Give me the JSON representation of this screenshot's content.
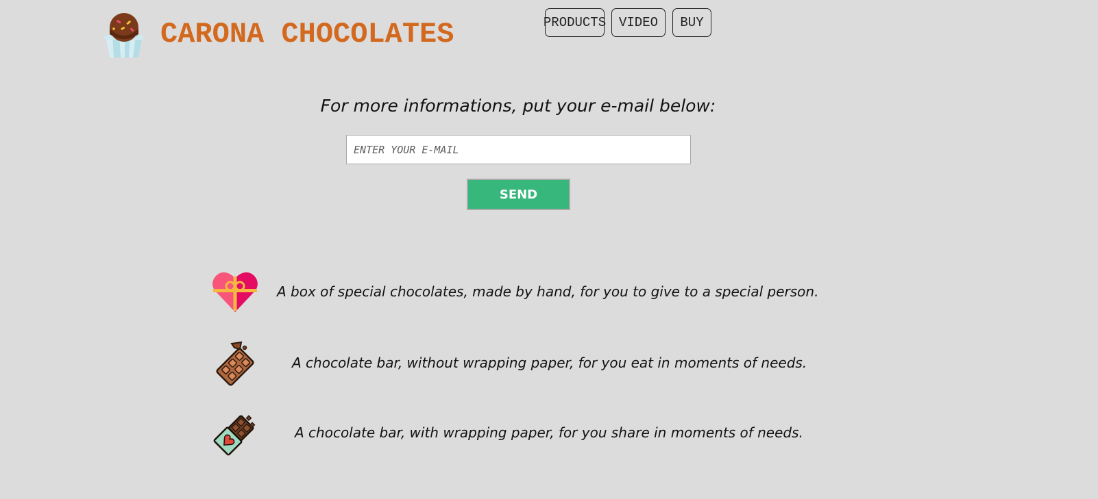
{
  "header": {
    "brand": "CARONA CHOCOLATES",
    "logo_icon": "chocolate-cupcake-icon",
    "nav": [
      {
        "label": "PRODUCTS"
      },
      {
        "label": "VIDEO"
      },
      {
        "label": "BUY"
      }
    ]
  },
  "newsletter": {
    "prompt": "For more informations, put your e-mail below:",
    "email_placeholder": "ENTER YOUR E-MAIL",
    "send_label": "SEND"
  },
  "products": [
    {
      "icon": "heart-gift-box-icon",
      "text": "A box of special chocolates, made by hand, for you to give to a special person."
    },
    {
      "icon": "chocolate-bar-icon",
      "text": "A chocolate bar, without wrapping paper, for you eat in moments of needs."
    },
    {
      "icon": "wrapped-chocolate-bar-icon",
      "text": "A chocolate bar, with wrapping paper, for you share in moments of needs."
    }
  ],
  "colors": {
    "background": "#dcdcdc",
    "brand": "#d2691e",
    "send_button": "#37b77b"
  }
}
